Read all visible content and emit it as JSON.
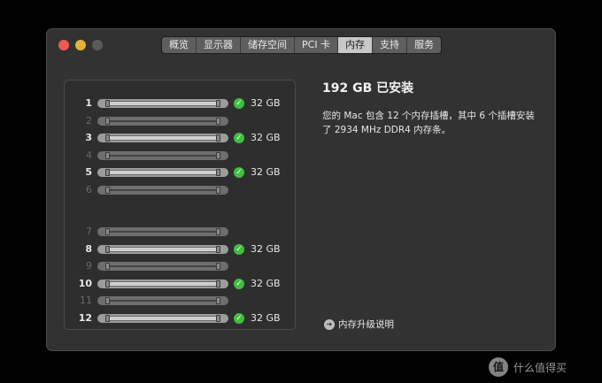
{
  "tabs": [
    {
      "label": "概览",
      "active": false
    },
    {
      "label": "显示器",
      "active": false
    },
    {
      "label": "储存空间",
      "active": false
    },
    {
      "label": "PCI 卡",
      "active": false
    },
    {
      "label": "内存",
      "active": true
    },
    {
      "label": "支持",
      "active": false
    },
    {
      "label": "服务",
      "active": false
    }
  ],
  "slots": [
    {
      "number": "1",
      "installed": true,
      "size": "32 GB"
    },
    {
      "number": "2",
      "installed": false,
      "size": ""
    },
    {
      "number": "3",
      "installed": true,
      "size": "32 GB"
    },
    {
      "number": "4",
      "installed": false,
      "size": ""
    },
    {
      "number": "5",
      "installed": true,
      "size": "32 GB"
    },
    {
      "number": "6",
      "installed": false,
      "size": ""
    },
    {
      "number": "7",
      "installed": false,
      "size": ""
    },
    {
      "number": "8",
      "installed": true,
      "size": "32 GB"
    },
    {
      "number": "9",
      "installed": false,
      "size": ""
    },
    {
      "number": "10",
      "installed": true,
      "size": "32 GB"
    },
    {
      "number": "11",
      "installed": false,
      "size": ""
    },
    {
      "number": "12",
      "installed": true,
      "size": "32 GB"
    }
  ],
  "summary": {
    "installed_title": "192 GB 已安装",
    "description": "您的 Mac 包含 12 个内存插槽，其中 6 个插槽安装了 2934 MHz DDR4 内存条。"
  },
  "help": {
    "label": "内存升级说明",
    "icon": "arrow-right-circle-icon"
  },
  "watermark": {
    "badge": "值",
    "text": "什么值得买"
  },
  "colors": {
    "window_bg": "#323232",
    "close": "#ee5a52",
    "minimize": "#e3b33c",
    "zoom_inactive": "#5a5a5a",
    "check_green": "#3fbf3f",
    "active_tab": "#c8c8c8"
  }
}
